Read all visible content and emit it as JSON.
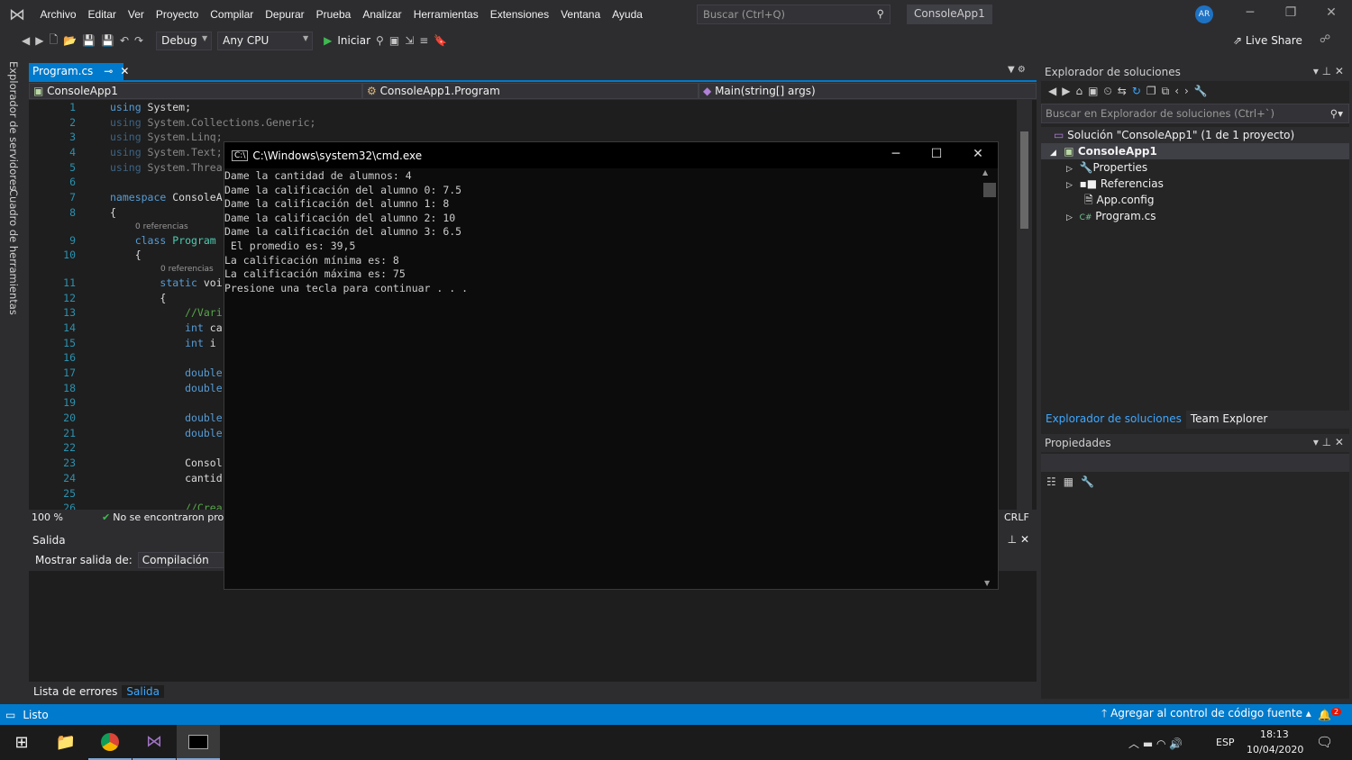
{
  "menu": {
    "items": [
      "Archivo",
      "Editar",
      "Ver",
      "Proyecto",
      "Compilar",
      "Depurar",
      "Prueba",
      "Analizar",
      "Herramientas",
      "Extensiones",
      "Ventana",
      "Ayuda"
    ],
    "search_placeholder": "Buscar (Ctrl+Q)",
    "solution_name": "ConsoleApp1",
    "avatar": "AR"
  },
  "toolbar": {
    "config": "Debug",
    "platform": "Any CPU",
    "start": "Iniciar",
    "live_share": "Live Share"
  },
  "left_strip": [
    "Explorador de servidores",
    "Cuadro de herramientas"
  ],
  "editor": {
    "tab": "Program.cs",
    "nav": [
      "ConsoleApp1",
      "ConsoleApp1.Program",
      "Main(string[] args)"
    ],
    "lens": "0 referencias",
    "lines": [
      {
        "n": "1",
        "t": "using System;"
      },
      {
        "n": "2",
        "t": "using System.Collections.Generic;"
      },
      {
        "n": "3",
        "t": "using System.Linq;"
      },
      {
        "n": "4",
        "t": "using System.Text;"
      },
      {
        "n": "5",
        "t": "using System.Threa"
      },
      {
        "n": "6",
        "t": ""
      },
      {
        "n": "7",
        "t": "namespace ConsoleA"
      },
      {
        "n": "8",
        "t": "{"
      },
      {
        "n": "9",
        "t": "    class Program"
      },
      {
        "n": "10",
        "t": "    {"
      },
      {
        "n": "11",
        "t": "        static voi"
      },
      {
        "n": "12",
        "t": "        {"
      },
      {
        "n": "13",
        "t": "            //Vari"
      },
      {
        "n": "14",
        "t": "            int ca"
      },
      {
        "n": "15",
        "t": "            int i"
      },
      {
        "n": "16",
        "t": ""
      },
      {
        "n": "17",
        "t": "            double"
      },
      {
        "n": "18",
        "t": "            double"
      },
      {
        "n": "19",
        "t": ""
      },
      {
        "n": "20",
        "t": "            double"
      },
      {
        "n": "21",
        "t": "            double"
      },
      {
        "n": "22",
        "t": ""
      },
      {
        "n": "23",
        "t": "            Consol"
      },
      {
        "n": "24",
        "t": "            cantid"
      },
      {
        "n": "25",
        "t": ""
      },
      {
        "n": "26",
        "t": "            //Crea"
      }
    ],
    "zoom": "100 %",
    "issues": "No se encontraron probl",
    "eol": "CRLF"
  },
  "output": {
    "title": "Salida",
    "show_from_label": "Mostrar salida de:",
    "show_from_value": "Compilación"
  },
  "bottom_tabs": [
    "Lista de errores",
    "Salida"
  ],
  "solution_explorer": {
    "title": "Explorador de soluciones",
    "search_placeholder": "Buscar en Explorador de soluciones (Ctrl+`)",
    "solution": "Solución \"ConsoleApp1\" (1 de 1 proyecto)",
    "project": "ConsoleApp1",
    "items": [
      "Properties",
      "Referencias",
      "App.config",
      "Program.cs"
    ],
    "tabs": [
      "Explorador de soluciones",
      "Team Explorer"
    ]
  },
  "properties": {
    "title": "Propiedades"
  },
  "cmd": {
    "title": "C:\\Windows\\system32\\cmd.exe",
    "lines": [
      "Dame la cantidad de alumnos: 4",
      "Dame la calificación del alumno 0: 7.5",
      "Dame la calificación del alumno 1: 8",
      "Dame la calificación del alumno 2: 10",
      "Dame la calificación del alumno 3: 6.5",
      " El promedio es: 39,5",
      "La calificación mínima es: 8",
      "La calificación máxima es: 75",
      "Presione una tecla para continuar . . ."
    ]
  },
  "status": {
    "text": "Listo",
    "source_control": "Agregar al control de código fuente",
    "notifications": "2"
  },
  "taskbar": {
    "time": "18:13",
    "date": "10/04/2020",
    "lang": "ESP"
  },
  "colors": {
    "accent": "#007acc",
    "background": "#2d2d30",
    "editor": "#1e1e1e"
  }
}
